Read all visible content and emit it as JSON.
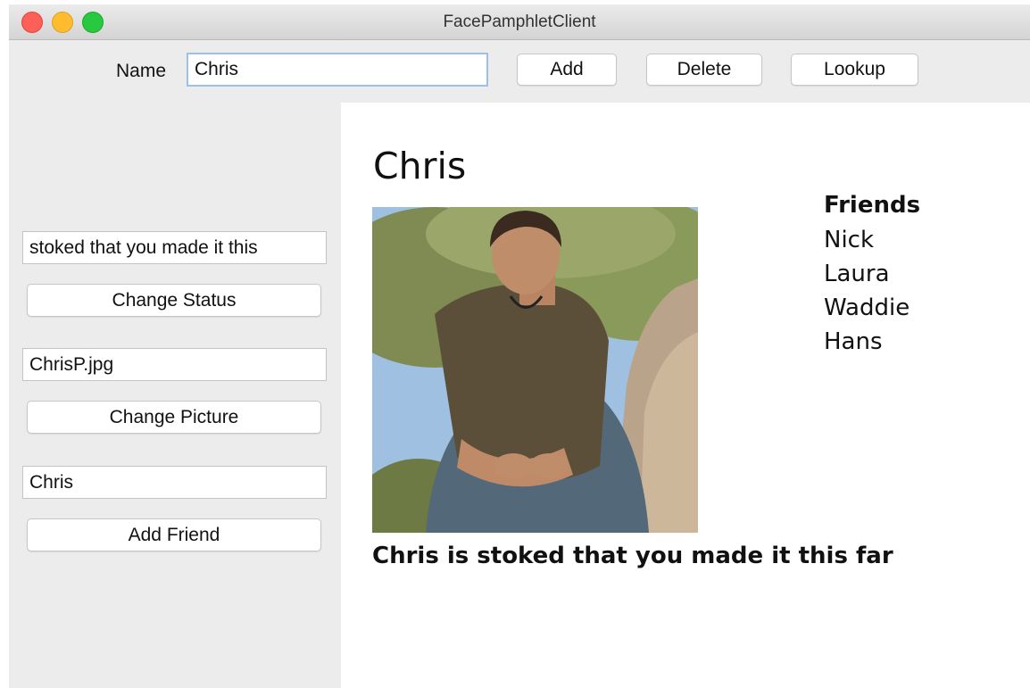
{
  "window": {
    "title": "FacePamphletClient"
  },
  "toolbar": {
    "name_label": "Name",
    "name_value": "Chris",
    "add_label": "Add",
    "delete_label": "Delete",
    "lookup_label": "Lookup"
  },
  "sidebar": {
    "status_value": "stoked that you made it this",
    "change_status_label": "Change Status",
    "picture_value": "ChrisP.jpg",
    "change_picture_label": "Change Picture",
    "friend_value": "Chris",
    "add_friend_label": "Add Friend"
  },
  "profile": {
    "name": "Chris",
    "friends_heading": "Friends",
    "friends": [
      "Nick",
      "Laura",
      "Waddie",
      "Hans"
    ],
    "status_message": "Chris is stoked that you made it this far"
  },
  "colors": {
    "window_bg": "#ececec",
    "canvas_bg": "#ffffff",
    "close": "#fe5f57",
    "minimize": "#febc2e",
    "zoom": "#28c840",
    "focus_ring": "#9cc0ea"
  }
}
